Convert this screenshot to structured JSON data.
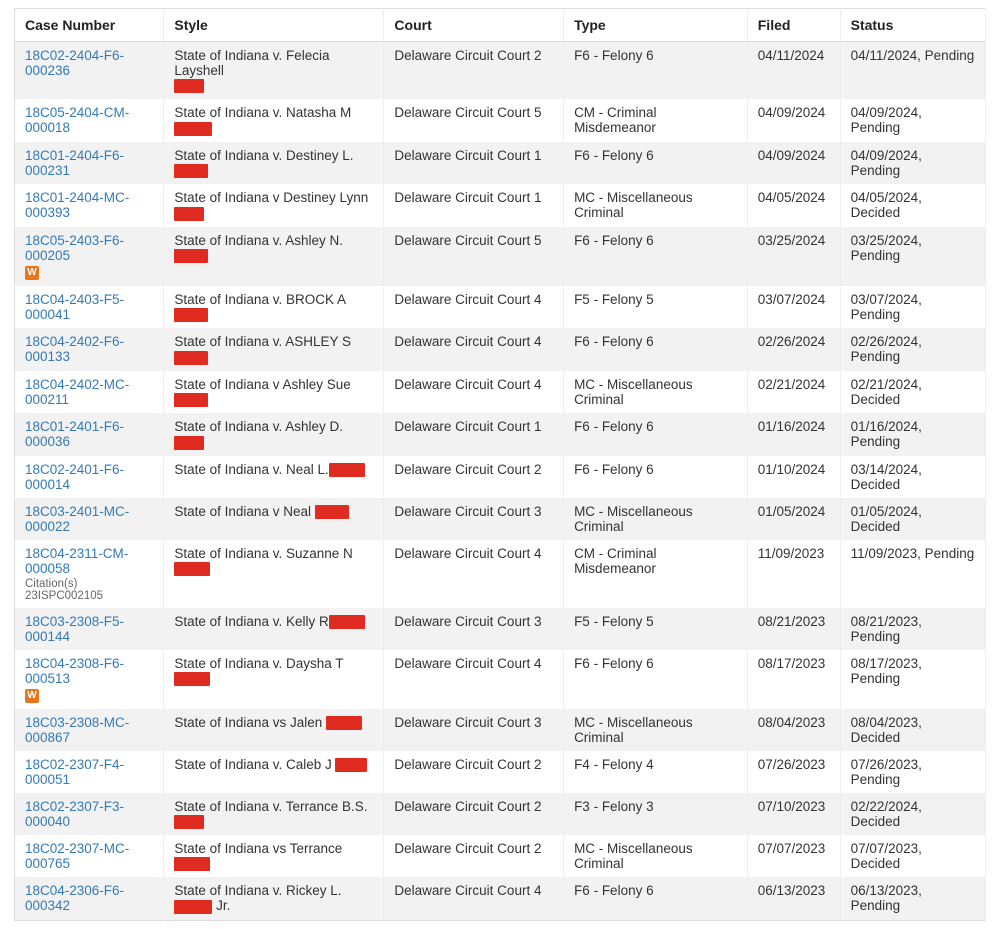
{
  "table": {
    "headers": {
      "case_number": "Case Number",
      "style": "Style",
      "court": "Court",
      "type": "Type",
      "filed": "Filed",
      "status": "Status"
    },
    "rows": [
      {
        "case_number": "18C02-2404-F6-000236",
        "style_prefix": "State of Indiana v. Felecia Layshell",
        "redact_width": 30,
        "redact_newline": true,
        "court": "Delaware Circuit Court 2",
        "type": "F6 - Felony 6",
        "filed": "04/11/2024",
        "status": "04/11/2024, Pending"
      },
      {
        "case_number": "18C05-2404-CM-000018",
        "style_prefix": "State of Indiana v. Natasha M ",
        "redact_width": 38,
        "court": "Delaware Circuit Court 5",
        "type": "CM - Criminal Misdemeanor",
        "filed": "04/09/2024",
        "status": "04/09/2024, Pending"
      },
      {
        "case_number": "18C01-2404-F6-000231",
        "style_prefix": "State of Indiana v. Destiney L. ",
        "redact_width": 34,
        "court": "Delaware Circuit Court 1",
        "type": "F6 - Felony 6",
        "filed": "04/09/2024",
        "status": "04/09/2024, Pending"
      },
      {
        "case_number": "18C01-2404-MC-000393",
        "style_prefix": "State of Indiana v Destiney Lynn",
        "redact_width": 30,
        "redact_newline": true,
        "court": "Delaware Circuit Court 1",
        "type": "MC - Miscellaneous Criminal",
        "filed": "04/05/2024",
        "status": "04/05/2024, Decided"
      },
      {
        "case_number": "18C05-2403-F6-000205",
        "w_badge": true,
        "style_prefix": "State of Indiana v. Ashley N. ",
        "redact_width": 34,
        "court": "Delaware Circuit Court 5",
        "type": "F6 - Felony 6",
        "filed": "03/25/2024",
        "status": "03/25/2024, Pending"
      },
      {
        "case_number": "18C04-2403-F5-000041",
        "style_prefix": "State of Indiana v. BROCK A ",
        "redact_width": 34,
        "court": "Delaware Circuit Court 4",
        "type": "F5 - Felony 5",
        "filed": "03/07/2024",
        "status": "03/07/2024, Pending"
      },
      {
        "case_number": "18C04-2402-F6-000133",
        "style_prefix": "State of Indiana v. ASHLEY S ",
        "redact_width": 34,
        "court": "Delaware Circuit Court 4",
        "type": "F6 - Felony 6",
        "filed": "02/26/2024",
        "status": "02/26/2024, Pending"
      },
      {
        "case_number": "18C04-2402-MC-000211",
        "style_prefix": "State of Indiana v Ashley Sue ",
        "redact_width": 34,
        "court": "Delaware Circuit Court 4",
        "type": "MC - Miscellaneous Criminal",
        "filed": "02/21/2024",
        "status": "02/21/2024, Decided"
      },
      {
        "case_number": "18C01-2401-F6-000036",
        "style_prefix": "State of Indiana v. Ashley D. ",
        "redact_width": 30,
        "court": "Delaware Circuit Court 1",
        "type": "F6 - Felony 6",
        "filed": "01/16/2024",
        "status": "01/16/2024, Pending"
      },
      {
        "case_number": "18C02-2401-F6-000014",
        "style_prefix": "State of Indiana v. Neal L.",
        "redact_width": 36,
        "court": "Delaware Circuit Court 2",
        "type": "F6 - Felony 6",
        "filed": "01/10/2024",
        "status": "03/14/2024, Decided"
      },
      {
        "case_number": "18C03-2401-MC-000022",
        "style_prefix": "State of Indiana v Neal ",
        "redact_width": 34,
        "court": "Delaware Circuit Court 3",
        "type": "MC - Miscellaneous Criminal",
        "filed": "01/05/2024",
        "status": "01/05/2024, Decided"
      },
      {
        "case_number": "18C04-2311-CM-000058",
        "citation": "Citation(s)  23ISPC002105",
        "style_prefix": "State of Indiana v. Suzanne N",
        "redact_width": 36,
        "court": "Delaware Circuit Court 4",
        "type": "CM - Criminal Misdemeanor",
        "filed": "11/09/2023",
        "status": "11/09/2023, Pending"
      },
      {
        "case_number": "18C03-2308-F5-000144",
        "style_prefix": "State of Indiana v. Kelly R",
        "redact_width": 36,
        "court": "Delaware Circuit Court 3",
        "type": "F5 - Felony 5",
        "filed": "08/21/2023",
        "status": "08/21/2023, Pending"
      },
      {
        "case_number": "18C04-2308-F6-000513",
        "w_badge": true,
        "style_prefix": "State of Indiana v. Daysha T ",
        "redact_width": 36,
        "court": "Delaware Circuit Court 4",
        "type": "F6 - Felony 6",
        "filed": "08/17/2023",
        "status": "08/17/2023, Pending"
      },
      {
        "case_number": "18C03-2308-MC-000867",
        "style_prefix": "State of Indiana vs Jalen ",
        "redact_width": 36,
        "court": "Delaware Circuit Court 3",
        "type": "MC - Miscellaneous Criminal",
        "filed": "08/04/2023",
        "status": "08/04/2023, Decided"
      },
      {
        "case_number": "18C02-2307-F4-000051",
        "style_prefix": "State of Indiana v. Caleb J ",
        "redact_width": 32,
        "court": "Delaware Circuit Court 2",
        "type": "F4 - Felony 4",
        "filed": "07/26/2023",
        "status": "07/26/2023, Pending"
      },
      {
        "case_number": "18C02-2307-F3-000040",
        "style_prefix": "State of Indiana v. Terrance B.S.",
        "redact_width": 30,
        "redact_newline": true,
        "court": "Delaware Circuit Court 2",
        "type": "F3 - Felony 3",
        "filed": "07/10/2023",
        "status": "02/22/2024, Decided"
      },
      {
        "case_number": "18C02-2307-MC-000765",
        "style_prefix": "State of Indiana vs Terrance ",
        "redact_width": 36,
        "court": "Delaware Circuit Court 2",
        "type": "MC - Miscellaneous Criminal",
        "filed": "07/07/2023",
        "status": "07/07/2023, Decided"
      },
      {
        "case_number": "18C04-2306-F6-000342",
        "style_prefix": "State of Indiana v. Rickey L. ",
        "style_suffix": " Jr.",
        "redact_width": 38,
        "court": "Delaware Circuit Court 4",
        "type": "F6 - Felony 6",
        "filed": "06/13/2023",
        "status": "06/13/2023, Pending"
      }
    ]
  },
  "labels": {
    "w_badge": "W"
  }
}
